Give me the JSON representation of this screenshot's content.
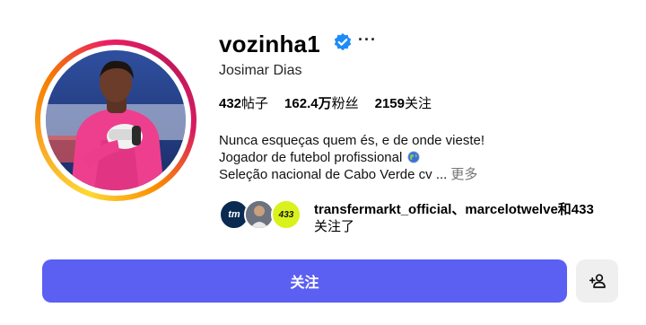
{
  "profile": {
    "username": "vozinha1",
    "full_name": "Josimar Dias",
    "more_options": "···",
    "stats": {
      "posts": "432",
      "posts_label": "帖子",
      "followers": "162.4万",
      "followers_label": "粉丝",
      "following": "2159",
      "following_label": "关注"
    },
    "bio": {
      "line1": "Nunca esqueças quem és, e de onde vieste!",
      "line2": "Jogador de futebol profissional",
      "line3": "Seleção nacional de Cabo Verde cv ...",
      "more_label": "更多"
    },
    "followed_by": {
      "names": "transfermarkt_official、marcelotwelve和433",
      "suffix": "关注了",
      "avatar1_text": "tm",
      "avatar3_text": "433"
    }
  },
  "actions": {
    "follow_label": "关注"
  },
  "icons": {
    "verified": "verified-badge-icon",
    "more": "more-options-icon",
    "globe": "globe-icon",
    "add_user": "add-user-icon"
  },
  "colors": {
    "follow_button": "#5b5ff2",
    "verified_blue": "#1d8cf8",
    "secondary_button": "#efefef"
  }
}
